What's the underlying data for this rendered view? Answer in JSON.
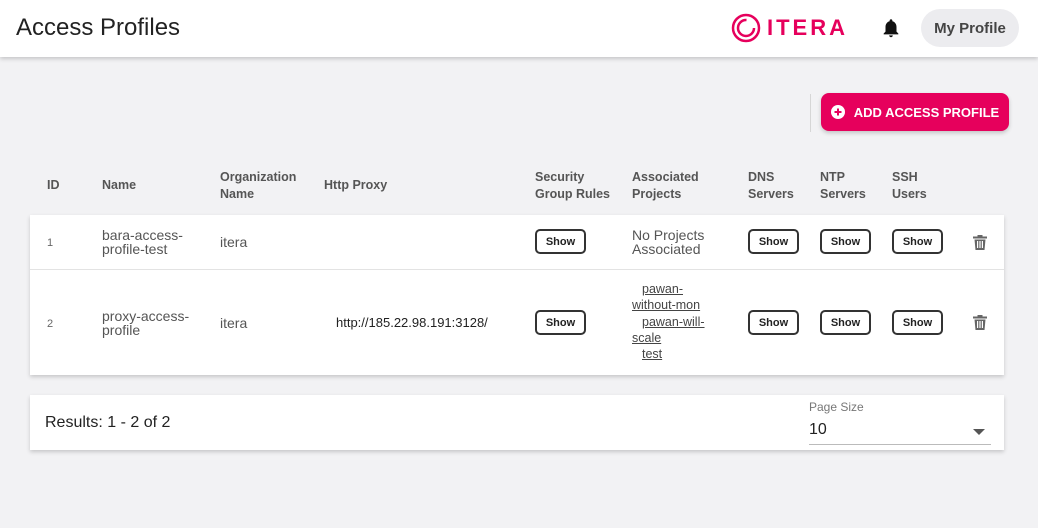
{
  "header": {
    "title": "Access Profiles",
    "logo_text": "ITERA",
    "profile_label": "My Profile",
    "brand_color": "#e6005c"
  },
  "actions": {
    "add_label": "ADD ACCESS PROFILE"
  },
  "table": {
    "columns": {
      "id": "ID",
      "name": "Name",
      "org_1": "Organization",
      "org_2": "Name",
      "proxy": "Http Proxy",
      "sg_1": "Security",
      "sg_2": "Group Rules",
      "proj_1": "Associated",
      "proj_2": "Projects",
      "dns_1": "DNS",
      "dns_2": "Servers",
      "ntp_1": "NTP",
      "ntp_2": "Servers",
      "ssh_1": "SSH",
      "ssh_2": "Users"
    },
    "rows": [
      {
        "id": "1",
        "name_1": "bara-access-",
        "name_2": "profile-test",
        "org": "itera",
        "proxy": "",
        "show": "Show",
        "projects_1": "No Projects",
        "projects_2": "Associated"
      },
      {
        "id": "2",
        "name_1": "proxy-access-",
        "name_2": "profile",
        "org": "itera",
        "proxy": "http://185.22.98.191:3128/",
        "show": "Show",
        "project_links": [
          "pawan-",
          "without-mon",
          "pawan-will-",
          "scale",
          "test"
        ]
      }
    ]
  },
  "footer": {
    "results": "Results: 1 - 2 of 2",
    "page_size_label": "Page Size",
    "page_size_value": "10"
  },
  "icons": {
    "logo": "itera-logo-icon",
    "bell": "bell-icon",
    "add": "plus-circle-icon",
    "delete": "trash-icon",
    "dropdown": "caret-down-icon"
  }
}
